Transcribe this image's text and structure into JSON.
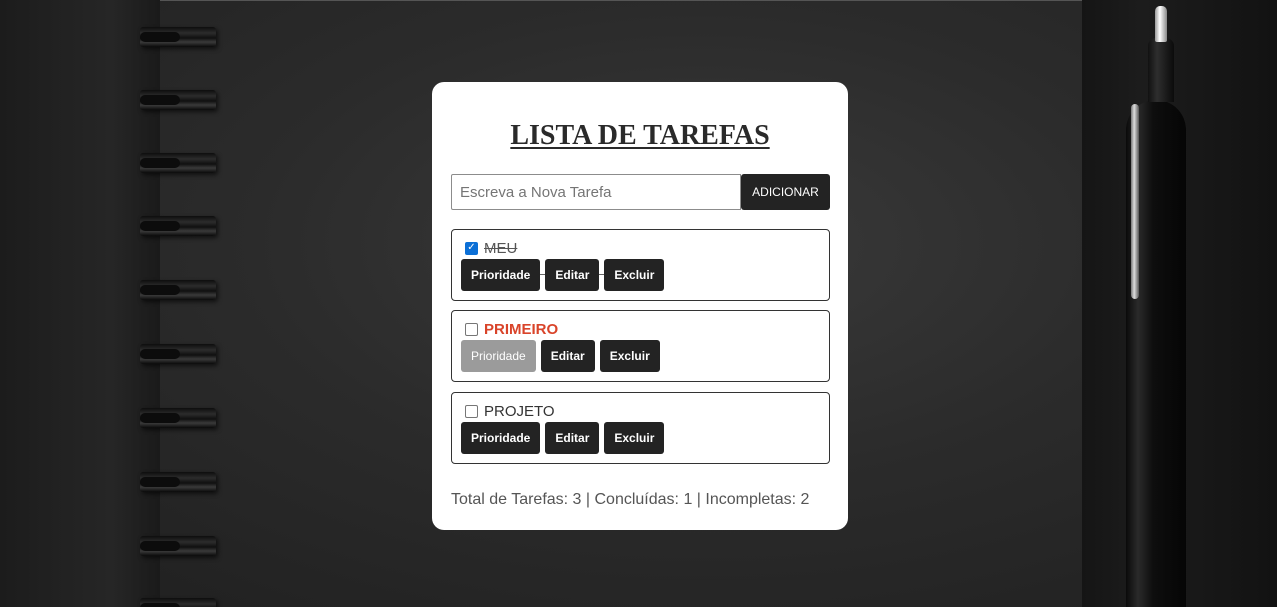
{
  "title": "LISTA DE TAREFAS",
  "new_task": {
    "placeholder": "Escreva a Nova Tarefa",
    "add_label": "ADICIONAR"
  },
  "tasks": [
    {
      "name": "MEU",
      "completed": true,
      "priority": false
    },
    {
      "name": "PRIMEIRO",
      "completed": false,
      "priority": true
    },
    {
      "name": "PROJETO",
      "completed": false,
      "priority": false
    }
  ],
  "actions": {
    "priority_label": "Prioridade",
    "edit_label": "Editar",
    "delete_label": "Excluir"
  },
  "summary": "Total de Tarefas: 3 | Concluídas: 1 | Incompletas: 2",
  "colors": {
    "priority_text": "#d9442a",
    "button_bg": "#232323",
    "priority_active_bg": "#9b9b9b",
    "checkbox_checked": "#0b6fd6"
  }
}
